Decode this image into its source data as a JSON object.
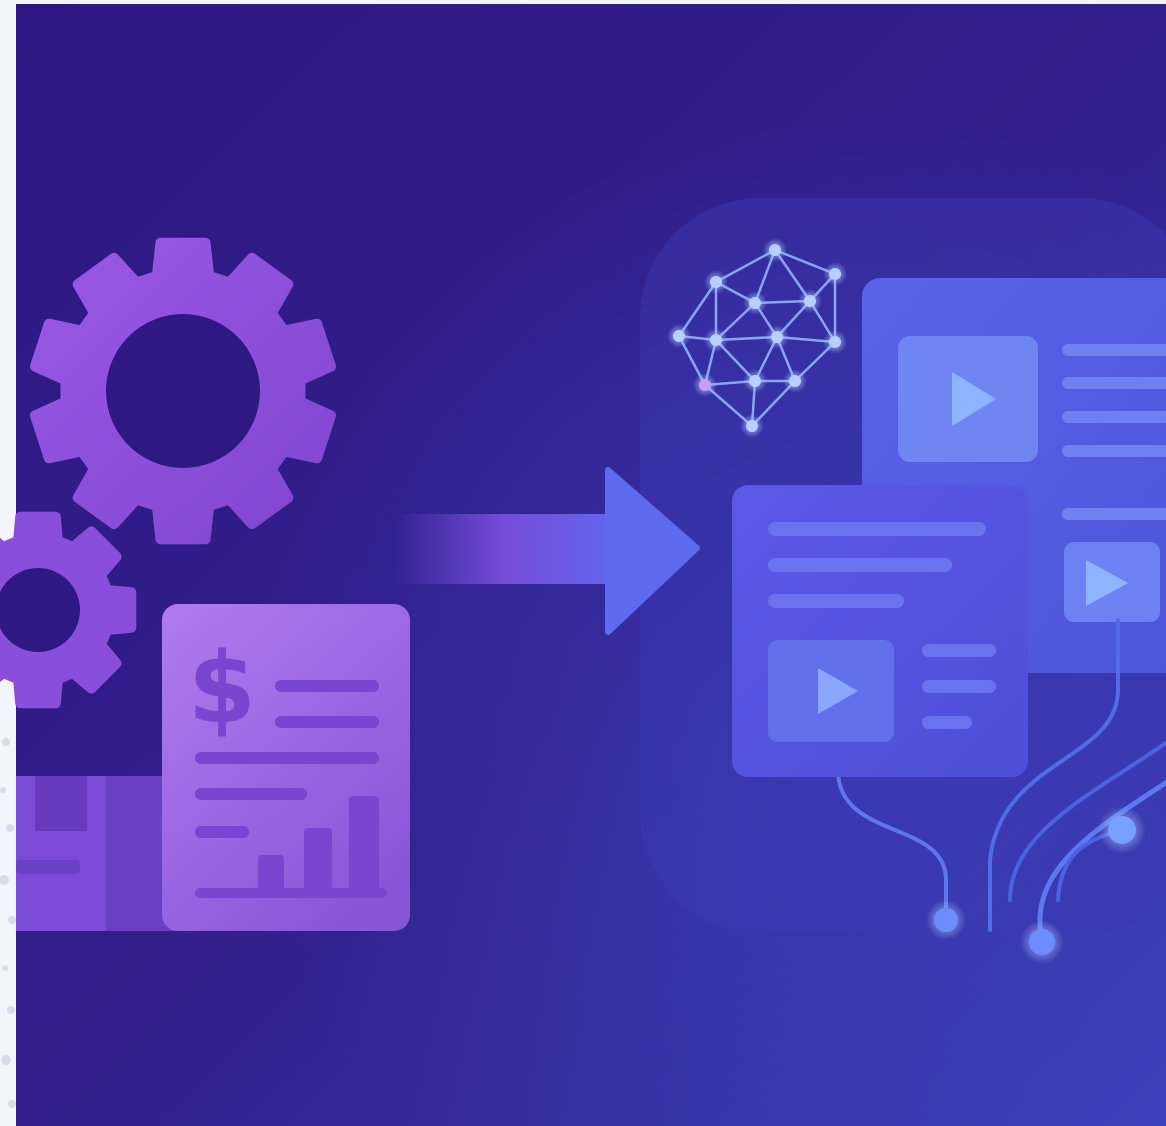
{
  "colors": {
    "background_dark": "#2d1680",
    "background_light": "#3b3fb8",
    "gear": "#8f52dc",
    "document": "#9c62e6",
    "arrow": "#6c5cf0",
    "media_card": "#5b57e6",
    "accent_blue": "#5e8cff",
    "network_glow": "#9fc0ff"
  },
  "icons": {
    "gear_large": "gear-icon",
    "gear_small": "gear-icon",
    "invoice": "invoice-document-icon",
    "currency": "dollar-sign-icon",
    "box": "package-box-icon",
    "transform_arrow": "arrow-right-icon",
    "ai_network": "neural-network-icon",
    "video_card": "video-content-card-icon",
    "play": "play-icon",
    "circuit": "circuit-lines-icon"
  },
  "invoice": {
    "currency_symbol": "$"
  }
}
